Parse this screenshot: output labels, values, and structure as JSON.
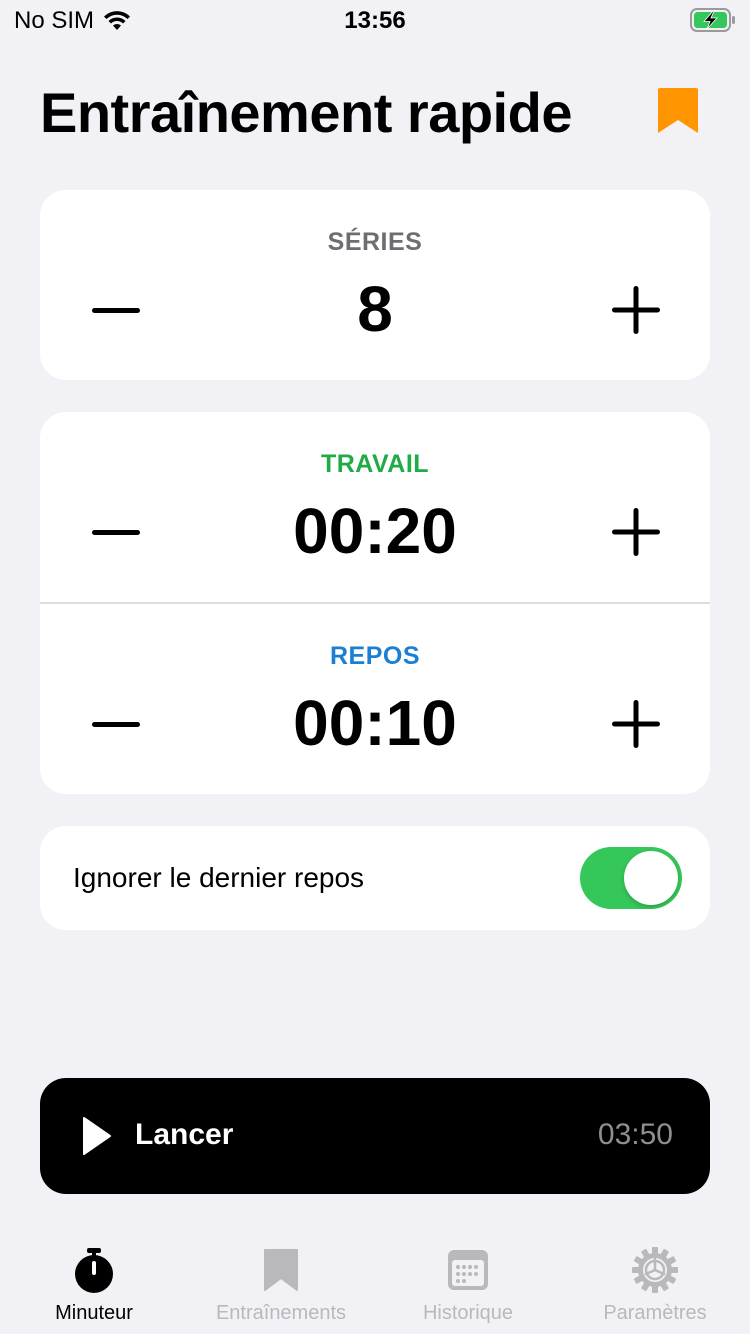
{
  "status_bar": {
    "carrier": "No SIM",
    "time": "13:56"
  },
  "header": {
    "title": "Entraînement rapide",
    "bookmark_icon": "bookmark-icon"
  },
  "series": {
    "label": "SÉRIES",
    "value": "8",
    "label_color": "#6d6d72"
  },
  "work": {
    "label": "TRAVAIL",
    "value": "00:20",
    "label_color": "#1fab46"
  },
  "rest": {
    "label": "REPOS",
    "value": "00:10",
    "label_color": "#1b7fd3"
  },
  "skip_last_rest": {
    "label": "Ignorer le dernier repos",
    "on": true
  },
  "launch": {
    "label": "Lancer",
    "duration": "03:50"
  },
  "tabs": [
    {
      "label": "Minuteur",
      "icon": "stopwatch-icon",
      "active": true
    },
    {
      "label": "Entraînements",
      "icon": "bookmark-icon",
      "active": false
    },
    {
      "label": "Historique",
      "icon": "calendar-icon",
      "active": false
    },
    {
      "label": "Paramètres",
      "icon": "gear-icon",
      "active": false
    }
  ],
  "colors": {
    "accent_orange": "#ff9500",
    "toggle_green": "#35c759",
    "background": "#f1f1f6"
  }
}
